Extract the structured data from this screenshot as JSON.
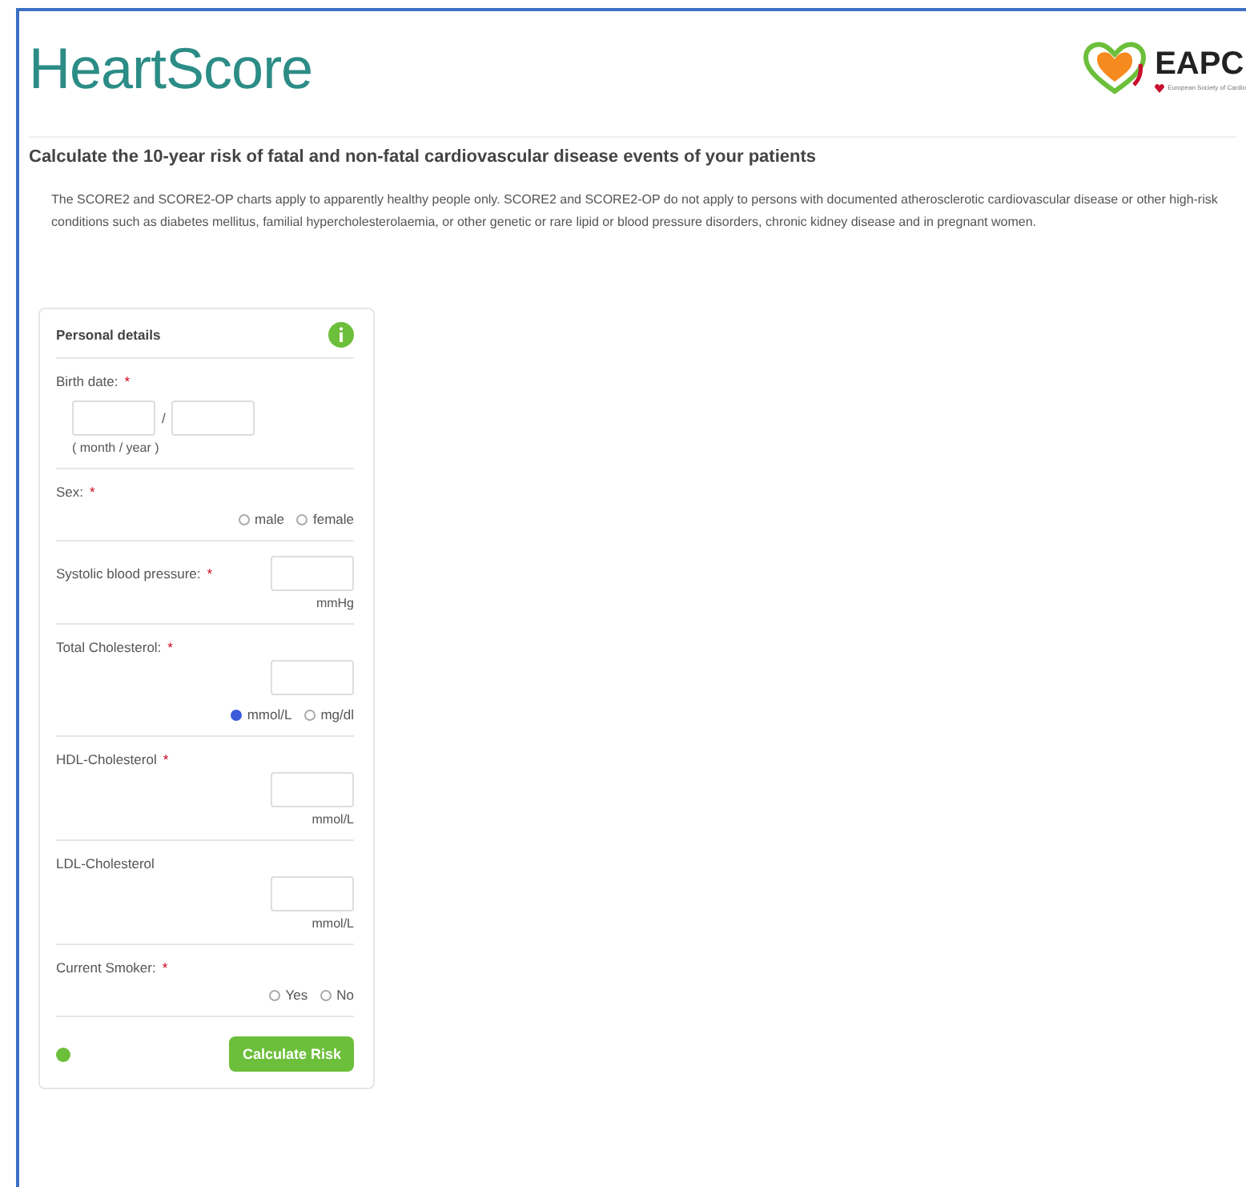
{
  "header": {
    "logo_text": "HeartScore",
    "partner_logo": "EAPC",
    "partner_subtitle": "European Society of Cardio"
  },
  "title": "Calculate the 10-year risk of fatal and non-fatal cardiovascular disease events of your patients",
  "intro": "The SCORE2 and SCORE2-OP charts apply to apparently healthy people only. SCORE2 and SCORE2-OP do not apply to persons with documented atherosclerotic cardiovascular disease or other high-risk conditions such as diabetes mellitus, familial hypercholesterolaemia, or other genetic or rare lipid or blood pressure disorders, chronic kidney disease and in pregnant women.",
  "panel": {
    "title": "Personal details",
    "fields": [
      {
        "kind": "date",
        "label": "Birth date:",
        "required_mark": "*",
        "separator": "/",
        "hint": "( month / year )"
      },
      {
        "kind": "radio",
        "label": "Sex:",
        "required_mark": "*",
        "options": [
          {
            "label": "male",
            "selected": false
          },
          {
            "label": "female",
            "selected": false
          }
        ]
      },
      {
        "kind": "inline",
        "label": "Systolic blood pressure:",
        "required_mark": "*",
        "unit": "mmHg"
      },
      {
        "kind": "unit_choice",
        "label": "Total Cholesterol:",
        "required_mark": "*",
        "options": [
          {
            "label": "mmol/L",
            "selected": true
          },
          {
            "label": "mg/dl",
            "selected": false
          }
        ]
      },
      {
        "kind": "number",
        "label": "HDL-Cholesterol",
        "required_mark": "*",
        "unit": "mmol/L"
      },
      {
        "kind": "number",
        "label": "LDL-Cholesterol",
        "unit": "mmol/L"
      },
      {
        "kind": "radio",
        "label": "Current Smoker:",
        "required_mark": "*",
        "options": [
          {
            "label": "Yes",
            "selected": false
          },
          {
            "label": "No",
            "selected": false
          }
        ]
      }
    ],
    "submit": "Calculate Risk"
  }
}
